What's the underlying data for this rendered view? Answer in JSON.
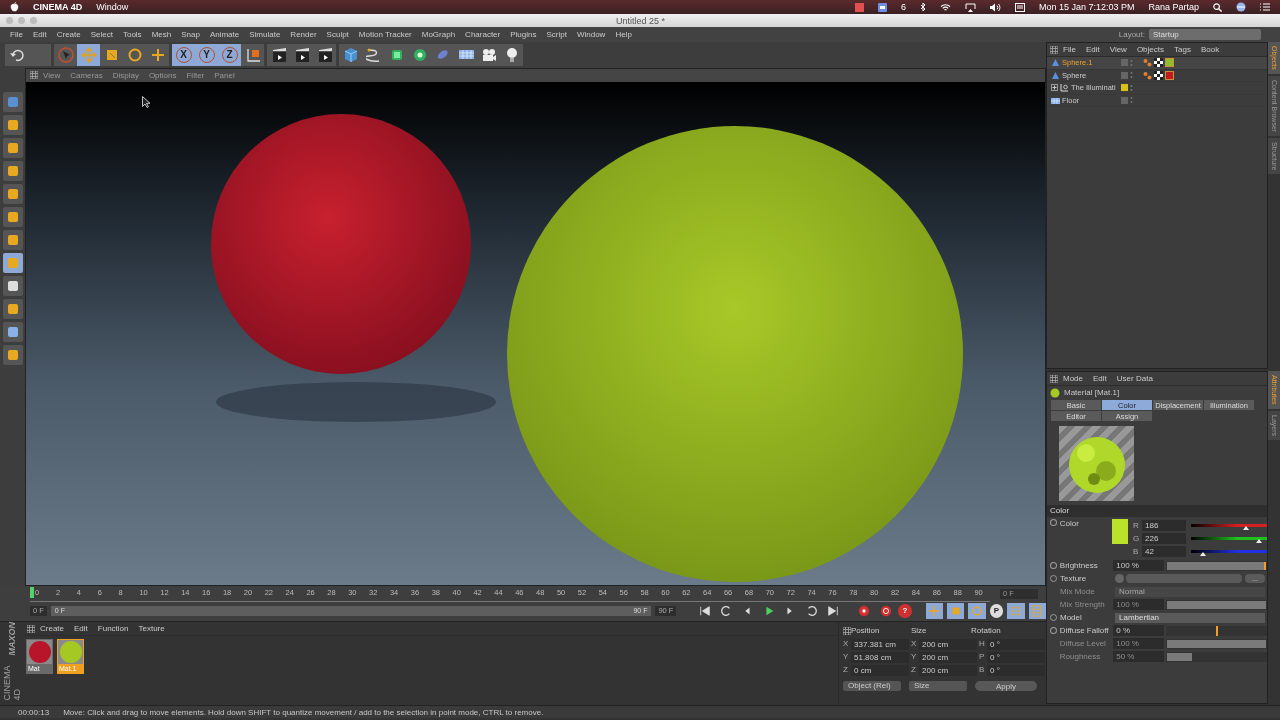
{
  "mac_menubar": {
    "app": "CINEMA 4D",
    "menus": [
      "Window"
    ],
    "badge": "6",
    "clock": "Mon 15 Jan  7:12:03 PM",
    "user": "Rana Partap"
  },
  "window": {
    "title": "Untitled 25 *"
  },
  "menu": [
    "File",
    "Edit",
    "Create",
    "Select",
    "Tools",
    "Mesh",
    "Snap",
    "Animate",
    "Simulate",
    "Render",
    "Sculpt",
    "Motion Tracker",
    "MoGraph",
    "Character",
    "Plugins",
    "Script",
    "Window",
    "Help"
  ],
  "layout": {
    "label": "Layout:",
    "value": "Startup"
  },
  "toolbar": [
    {
      "kind": "undo",
      "selected": false
    },
    {
      "kind": "blank",
      "selected": false
    },
    {
      "kind": "select",
      "selected": false
    },
    {
      "kind": "move",
      "selected": true
    },
    {
      "kind": "scale",
      "selected": false
    },
    {
      "kind": "rotate",
      "selected": false
    },
    {
      "kind": "add",
      "selected": false
    },
    {
      "kind": "axis",
      "label": "X",
      "selected": true
    },
    {
      "kind": "axis",
      "label": "Y",
      "selected": true
    },
    {
      "kind": "axis",
      "label": "Z",
      "selected": true
    },
    {
      "kind": "coords",
      "selected": false
    },
    {
      "kind": "render",
      "selected": false
    },
    {
      "kind": "render",
      "selected": false
    },
    {
      "kind": "render",
      "selected": false
    },
    {
      "kind": "cube",
      "selected": false
    },
    {
      "kind": "spline",
      "selected": false
    },
    {
      "kind": "nurbs",
      "selected": false
    },
    {
      "kind": "array",
      "selected": false
    },
    {
      "kind": "deformer",
      "selected": false
    },
    {
      "kind": "floor",
      "selected": false
    },
    {
      "kind": "camera",
      "selected": false
    },
    {
      "kind": "light",
      "selected": false
    }
  ],
  "viewport": {
    "menu": [
      "View",
      "Cameras",
      "Display",
      "Options",
      "Filter",
      "Panel"
    ]
  },
  "timeline": {
    "ticks": [
      "0",
      "2",
      "4",
      "6",
      "8",
      "10",
      "12",
      "14",
      "16",
      "18",
      "20",
      "22",
      "24",
      "26",
      "28",
      "30",
      "32",
      "34",
      "36",
      "38",
      "40",
      "42",
      "44",
      "46",
      "48",
      "50",
      "52",
      "54",
      "56",
      "58",
      "60",
      "62",
      "64",
      "66",
      "68",
      "70",
      "72",
      "74",
      "76",
      "78",
      "80",
      "82",
      "84",
      "86",
      "88",
      "90"
    ],
    "current_frame": "0 F",
    "playhead": {
      "level": 0
    },
    "start_field": "0 F",
    "range": {
      "start": "0 F",
      "end": "90 F",
      "level": 1
    },
    "end_field": "90 F",
    "help_button": "?",
    "pivot_button": "P"
  },
  "materials": {
    "menu": [
      "Create",
      "Edit",
      "Function",
      "Texture"
    ],
    "items": [
      {
        "name": "Mat",
        "color": "#b8142a",
        "selected": false
      },
      {
        "name": "Mat.1",
        "color": "#a6c824",
        "selected": true
      }
    ],
    "logo": {
      "brand": "MAXON",
      "product": "CINEMA 4D"
    }
  },
  "coordinates": {
    "headers": [
      "Position",
      "Size",
      "Rotation"
    ],
    "rows": [
      [
        {
          "axis": "X",
          "value": "337.381 cm"
        },
        {
          "axis": "X",
          "value": "200 cm"
        },
        {
          "axis": "H",
          "value": "0 °"
        }
      ],
      [
        {
          "axis": "Y",
          "value": "51.808 cm"
        },
        {
          "axis": "Y",
          "value": "200 cm"
        },
        {
          "axis": "P",
          "value": "0 °"
        }
      ],
      [
        {
          "axis": "Z",
          "value": "0 cm"
        },
        {
          "axis": "Z",
          "value": "200 cm"
        },
        {
          "axis": "B",
          "value": "0 °"
        }
      ]
    ],
    "mode": "Object (Rel)",
    "size_mode": "Size",
    "apply": "Apply"
  },
  "status_bar": {
    "time": "00:00:13",
    "message": "Move: Click and drag to move elements. Hold down SHIFT to quantize movement / add to the selection in point mode, CTRL to remove."
  },
  "objects": {
    "menu": [
      "File",
      "Edit",
      "View",
      "Objects",
      "Tags",
      "Book"
    ],
    "items": [
      {
        "name": "Sphere.1",
        "kind": "sphere",
        "selected": true,
        "color": "#8fbf2a"
      },
      {
        "name": "Sphere",
        "kind": "sphere",
        "selected": false,
        "color": "#c01c20"
      },
      {
        "name": "The Illuminati",
        "kind": "null",
        "selected": false,
        "expanded": false,
        "color": "#d8c21a"
      },
      {
        "name": "Floor",
        "kind": "floor",
        "selected": false
      }
    ]
  },
  "side_tabs_top": [
    {
      "label": "Objects",
      "selected": true
    },
    {
      "label": "Content Browser",
      "selected": false
    },
    {
      "label": "Structure",
      "selected": false
    }
  ],
  "side_tabs_bottom": [
    {
      "label": "Attributes",
      "selected": true
    },
    {
      "label": "Layers",
      "selected": false
    }
  ],
  "attributes": {
    "menu": [
      "Mode",
      "Edit",
      "User Data"
    ],
    "title": "Material [Mat.1]",
    "tabs": [
      {
        "label": "Basic",
        "selected": false
      },
      {
        "label": "Color",
        "selected": true
      },
      {
        "label": "Displacement",
        "selected": false
      },
      {
        "label": "Illumination",
        "selected": false
      },
      {
        "label": "Editor",
        "selected": false
      },
      {
        "label": "Assign",
        "selected": false
      }
    ],
    "section": "Color",
    "params": [
      {
        "kind": "color",
        "label": "Color",
        "color": "#bae22a",
        "channels": [
          {
            "label": "R",
            "value": "186",
            "level": 0.73,
            "color": "#d42020"
          },
          {
            "label": "G",
            "value": "226",
            "level": 0.89,
            "color": "#20c020"
          },
          {
            "label": "B",
            "value": "42",
            "level": 0.16,
            "color": "#2030e0"
          }
        ]
      },
      {
        "kind": "percent",
        "label": "Brightness",
        "value": "100 %",
        "level": 1,
        "disabled": false
      },
      {
        "kind": "texture",
        "label": "Texture",
        "button": "...",
        "disabled": false
      },
      {
        "kind": "dropdown",
        "label": "Mix Mode",
        "value": "Normal",
        "disabled": true
      },
      {
        "kind": "percent",
        "label": "Mix Strength",
        "value": "100 %",
        "level": 1,
        "disabled": true
      },
      {
        "kind": "dropdown",
        "label": "Model",
        "value": "Lambertian",
        "disabled": false
      },
      {
        "kind": "percent",
        "label": "Diffuse Falloff",
        "value": "0 %",
        "level": 0.5,
        "disabled": false
      },
      {
        "kind": "percent",
        "label": "Diffuse Level",
        "value": "100 %",
        "level": 1,
        "disabled": true
      },
      {
        "kind": "percent",
        "label": "Roughness",
        "value": "50 %",
        "level": 0.25,
        "disabled": true
      }
    ]
  }
}
